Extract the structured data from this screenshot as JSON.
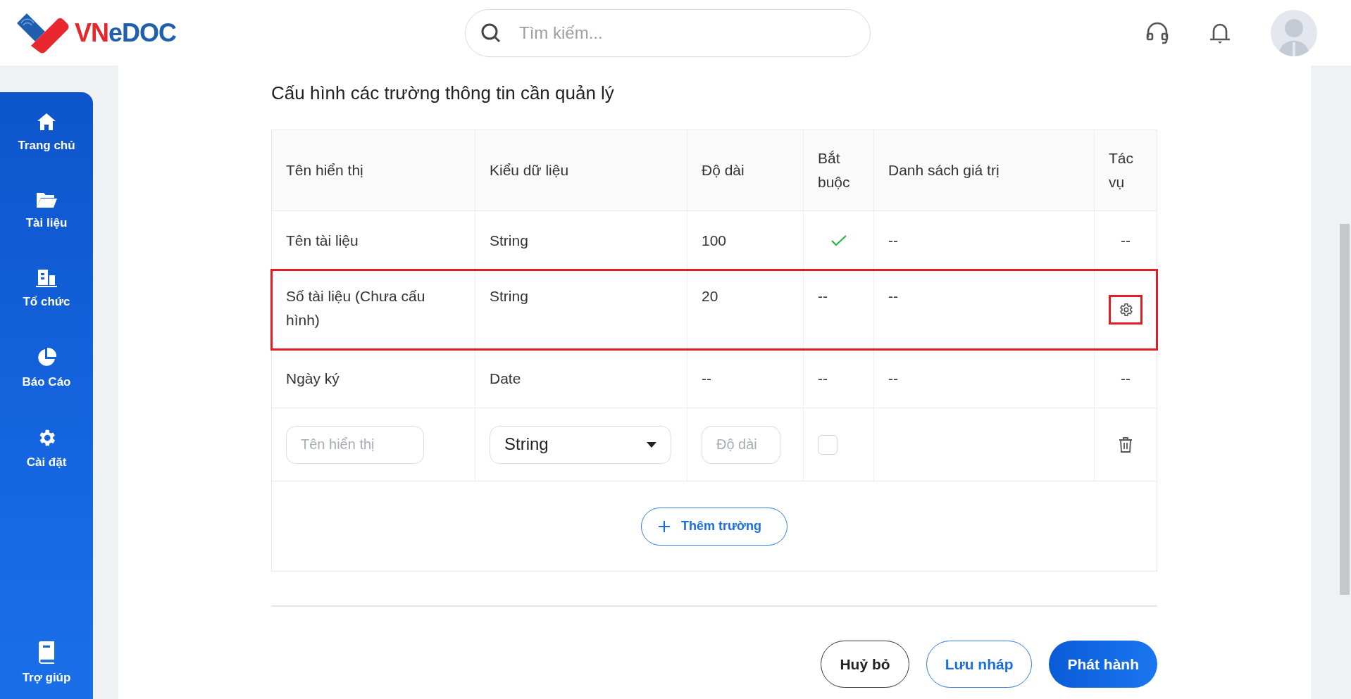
{
  "header": {
    "logo": {
      "part_1": "VN",
      "part_2": "eDOC"
    },
    "search": {
      "placeholder": "Tìm kiếm..."
    }
  },
  "sidebar": {
    "items": [
      {
        "label": "Trang chủ"
      },
      {
        "label": "Tài liệu"
      },
      {
        "label": "Tổ chức"
      },
      {
        "label": "Báo Cáo"
      },
      {
        "label": "Cài đặt"
      }
    ],
    "footer_item": {
      "label": "Trợ giúp"
    }
  },
  "section": {
    "title": "Cấu hình các trường thông tin cần quản lý"
  },
  "table": {
    "columns": [
      "Tên hiển thị",
      "Kiểu dữ liệu",
      "Độ dài",
      "Bắt buộc",
      "Danh sách giá trị",
      "Tác vụ"
    ],
    "rows": [
      {
        "kind": "data",
        "highlighted": false,
        "name": "Tên tài liệu",
        "type": "String",
        "length": "100",
        "required": true,
        "values": "--",
        "action": {
          "kind": "text",
          "text": "--"
        }
      },
      {
        "kind": "data",
        "highlighted": true,
        "name": "Số tài liệu (Chưa cấu hình)",
        "type": "String",
        "length": "20",
        "required": false,
        "required_text": "--",
        "values": "--",
        "action": {
          "kind": "settings"
        }
      },
      {
        "kind": "data",
        "highlighted": false,
        "name": "Ngày ký",
        "type": "Date",
        "length": "--",
        "required": false,
        "required_text": "--",
        "values": "--",
        "action": {
          "kind": "text",
          "text": "--"
        }
      },
      {
        "kind": "input",
        "name_placeholder": "Tên hiển thị",
        "type_value": "String",
        "length_placeholder": "Độ dài",
        "required": false,
        "action": {
          "kind": "delete"
        }
      }
    ],
    "add_button": "Thêm trường"
  },
  "footer_buttons": [
    {
      "kind": "outline",
      "label": "Huỷ bỏ"
    },
    {
      "kind": "secondary",
      "label": "Lưu nháp"
    },
    {
      "kind": "primary",
      "label": "Phát hành"
    }
  ]
}
